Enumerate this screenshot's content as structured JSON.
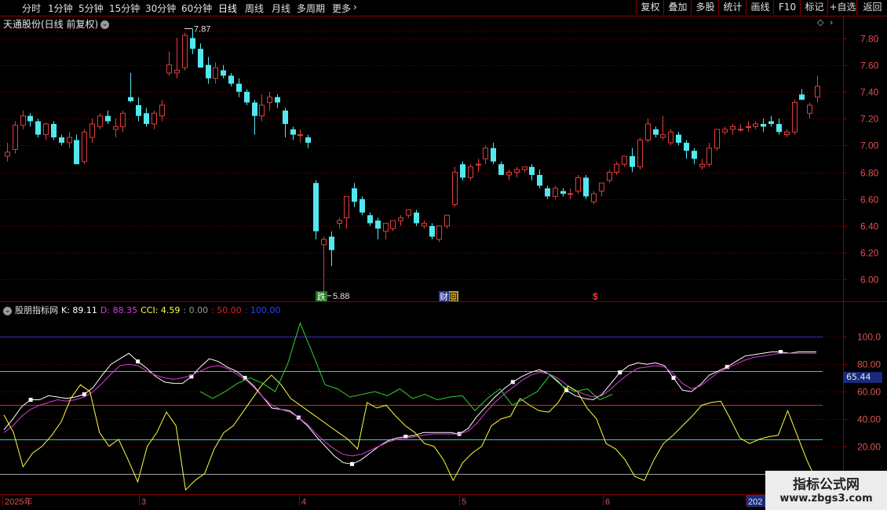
{
  "toolbar": {
    "left_items": [
      "分时",
      "1分钟",
      "5分钟",
      "15分钟",
      "30分钟",
      "60分钟",
      "日线",
      "周线",
      "月线",
      "多周期",
      "更多"
    ],
    "active": "日线",
    "right_items": [
      "复权",
      "叠加",
      "多股",
      "统计",
      "画线",
      "F10",
      "+自选",
      "返回",
      "标记"
    ]
  },
  "stock_title": "天通股份(日线 前复权)",
  "price_axis": [
    "7.80",
    "7.60",
    "7.40",
    "7.20",
    "7.00",
    "6.80",
    "6.60",
    "6.40",
    "6.20",
    "6.00"
  ],
  "indicator_axis": [
    "100.0",
    "80.00",
    "60.00",
    "40.00",
    "20.00"
  ],
  "current_value_label": "65.44",
  "high_label": "7.87",
  "low_label": "5.88",
  "event_markers": {
    "down": "跌",
    "finance": "财",
    "back": "回",
    "dollar": "$"
  },
  "indicator_legend": {
    "name": "股朋指标网",
    "k": "K: 89.11",
    "d": "D: 88.35",
    "cci": "CCI: 4.59",
    "l0": ": 0.00",
    "l50": ": 50.00",
    "l100": ": 100.00"
  },
  "date_labels": [
    "2025年",
    "3",
    "4",
    "5",
    "6",
    "202"
  ],
  "watermark": {
    "title": "指标公式网",
    "url": "www.zbgs3.com"
  },
  "colors": {
    "up": "#e03c3c",
    "down": "#52e8ee",
    "k": "#ffffff",
    "d": "#d040d0",
    "cci": "#ffff40",
    "rsi_green": "#30d030",
    "grid": "#8b0000"
  },
  "chart_data": [
    {
      "type": "candlestick",
      "title": "天通股份(日线 前复权)",
      "ylim": [
        5.85,
        7.92
      ],
      "candles_ohlc": [
        [
          6.92,
          7.02,
          6.88,
          6.95
        ],
        [
          6.97,
          7.18,
          6.94,
          7.15
        ],
        [
          7.15,
          7.26,
          7.12,
          7.22
        ],
        [
          7.22,
          7.24,
          7.14,
          7.18
        ],
        [
          7.18,
          7.2,
          7.06,
          7.08
        ],
        [
          7.08,
          7.17,
          7.04,
          7.16
        ],
        [
          7.16,
          7.18,
          7.04,
          7.06
        ],
        [
          7.06,
          7.08,
          7.0,
          7.02
        ],
        [
          7.02,
          7.1,
          6.98,
          7.06
        ],
        [
          7.04,
          7.08,
          6.88,
          6.86
        ],
        [
          6.88,
          7.12,
          6.86,
          7.1
        ],
        [
          7.06,
          7.2,
          7.02,
          7.16
        ],
        [
          7.14,
          7.24,
          7.12,
          7.22
        ],
        [
          7.22,
          7.26,
          7.16,
          7.18
        ],
        [
          7.12,
          7.2,
          7.06,
          7.14
        ],
        [
          7.14,
          7.26,
          7.1,
          7.24
        ],
        [
          7.36,
          7.54,
          7.32,
          7.33
        ],
        [
          7.3,
          7.36,
          7.18,
          7.22
        ],
        [
          7.24,
          7.28,
          7.14,
          7.16
        ],
        [
          7.16,
          7.26,
          7.12,
          7.24
        ],
        [
          7.22,
          7.34,
          7.18,
          7.3
        ],
        [
          7.54,
          7.7,
          7.52,
          7.6
        ],
        [
          7.54,
          7.8,
          7.5,
          7.56
        ],
        [
          7.58,
          7.84,
          7.56,
          7.82
        ],
        [
          7.8,
          7.87,
          7.68,
          7.72
        ],
        [
          7.72,
          7.76,
          7.58,
          7.58
        ],
        [
          7.6,
          7.66,
          7.46,
          7.5
        ],
        [
          7.5,
          7.62,
          7.46,
          7.58
        ],
        [
          7.56,
          7.6,
          7.5,
          7.52
        ],
        [
          7.52,
          7.54,
          7.44,
          7.46
        ],
        [
          7.46,
          7.5,
          7.36,
          7.4
        ],
        [
          7.4,
          7.42,
          7.3,
          7.32
        ],
        [
          7.32,
          7.34,
          7.08,
          7.22
        ],
        [
          7.22,
          7.38,
          7.18,
          7.3
        ],
        [
          7.32,
          7.4,
          7.26,
          7.36
        ],
        [
          7.36,
          7.38,
          7.28,
          7.32
        ],
        [
          7.26,
          7.28,
          7.06,
          7.16
        ],
        [
          7.12,
          7.14,
          7.04,
          7.08
        ],
        [
          7.08,
          7.12,
          7.02,
          7.08
        ],
        [
          7.06,
          7.08,
          6.98,
          7.02
        ],
        [
          6.72,
          6.74,
          6.3,
          6.36
        ],
        [
          6.26,
          6.32,
          5.88,
          6.3
        ],
        [
          6.32,
          6.36,
          6.1,
          6.22
        ],
        [
          6.42,
          6.46,
          6.38,
          6.44
        ],
        [
          6.46,
          6.62,
          6.38,
          6.62
        ],
        [
          6.68,
          6.72,
          6.54,
          6.58
        ],
        [
          6.6,
          6.62,
          6.48,
          6.5
        ],
        [
          6.48,
          6.5,
          6.4,
          6.42
        ],
        [
          6.44,
          6.46,
          6.3,
          6.38
        ],
        [
          6.36,
          6.42,
          6.3,
          6.42
        ],
        [
          6.38,
          6.44,
          6.36,
          6.44
        ],
        [
          6.44,
          6.48,
          6.4,
          6.46
        ],
        [
          6.48,
          6.52,
          6.46,
          6.52
        ],
        [
          6.5,
          6.52,
          6.4,
          6.42
        ],
        [
          6.4,
          6.44,
          6.38,
          6.42
        ],
        [
          6.4,
          6.42,
          6.3,
          6.32
        ],
        [
          6.3,
          6.4,
          6.28,
          6.4
        ],
        [
          6.4,
          6.48,
          6.38,
          6.48
        ],
        [
          6.56,
          6.84,
          6.54,
          6.8
        ],
        [
          6.86,
          6.88,
          6.74,
          6.76
        ],
        [
          6.76,
          6.86,
          6.74,
          6.84
        ],
        [
          6.86,
          6.9,
          6.8,
          6.86
        ],
        [
          6.9,
          7.0,
          6.86,
          6.98
        ],
        [
          6.98,
          7.02,
          6.86,
          6.88
        ],
        [
          6.86,
          6.88,
          6.78,
          6.78
        ],
        [
          6.78,
          6.82,
          6.74,
          6.8
        ],
        [
          6.8,
          6.84,
          6.76,
          6.82
        ],
        [
          6.82,
          6.84,
          6.8,
          6.84
        ],
        [
          6.84,
          6.86,
          6.74,
          6.78
        ],
        [
          6.78,
          6.82,
          6.68,
          6.7
        ],
        [
          6.68,
          6.7,
          6.6,
          6.62
        ],
        [
          6.62,
          6.7,
          6.6,
          6.68
        ],
        [
          6.66,
          6.68,
          6.62,
          6.64
        ],
        [
          6.64,
          6.68,
          6.6,
          6.64
        ],
        [
          6.66,
          6.78,
          6.64,
          6.76
        ],
        [
          6.76,
          6.78,
          6.6,
          6.62
        ],
        [
          6.58,
          6.66,
          6.56,
          6.64
        ],
        [
          6.66,
          6.72,
          6.62,
          6.72
        ],
        [
          6.74,
          6.82,
          6.72,
          6.8
        ],
        [
          6.8,
          6.88,
          6.78,
          6.86
        ],
        [
          6.86,
          6.92,
          6.84,
          6.92
        ],
        [
          6.92,
          6.98,
          6.8,
          6.84
        ],
        [
          6.84,
          7.06,
          6.82,
          7.04
        ],
        [
          7.04,
          7.2,
          7.02,
          7.16
        ],
        [
          7.12,
          7.14,
          7.06,
          7.08
        ],
        [
          7.06,
          7.22,
          7.04,
          7.08
        ],
        [
          7.02,
          7.12,
          7.0,
          7.1
        ],
        [
          7.08,
          7.1,
          7.0,
          7.02
        ],
        [
          7.02,
          7.04,
          6.9,
          6.96
        ],
        [
          6.96,
          6.98,
          6.86,
          6.9
        ],
        [
          6.84,
          6.9,
          6.82,
          6.86
        ],
        [
          6.86,
          7.02,
          6.84,
          6.98
        ],
        [
          6.98,
          7.12,
          6.96,
          7.12
        ],
        [
          7.1,
          7.14,
          7.08,
          7.12
        ],
        [
          7.12,
          7.16,
          7.08,
          7.14
        ],
        [
          7.12,
          7.16,
          7.1,
          7.12
        ],
        [
          7.14,
          7.18,
          7.1,
          7.14
        ],
        [
          7.14,
          7.18,
          7.12,
          7.16
        ],
        [
          7.16,
          7.2,
          7.1,
          7.14
        ],
        [
          7.18,
          7.22,
          7.14,
          7.16
        ],
        [
          7.16,
          7.2,
          7.08,
          7.1
        ],
        [
          7.08,
          7.12,
          7.06,
          7.1
        ],
        [
          7.1,
          7.34,
          7.08,
          7.32
        ],
        [
          7.38,
          7.42,
          7.34,
          7.34
        ],
        [
          7.24,
          7.32,
          7.2,
          7.3
        ],
        [
          7.36,
          7.52,
          7.32,
          7.44
        ]
      ]
    },
    {
      "type": "line",
      "title": "股朋指标网",
      "ylim": [
        -14,
        118
      ],
      "reference_lines": [
        {
          "value": 100,
          "color": "#2040ff"
        },
        {
          "value": 75,
          "color": "#40c8c8"
        },
        {
          "value": 50,
          "color": "#e02020"
        },
        {
          "value": 25,
          "color": "#40c8c8"
        },
        {
          "value": 0,
          "color": "#a0a0a0"
        }
      ],
      "series": [
        {
          "name": "K",
          "color": "#ffffff",
          "values": [
            32,
            40,
            49,
            54,
            54,
            57,
            56,
            55,
            56,
            58,
            63,
            72,
            80,
            84,
            88,
            82,
            77,
            71,
            67,
            66,
            66,
            71,
            78,
            84,
            82,
            78,
            75,
            70,
            64,
            56,
            48,
            47,
            46,
            41,
            35,
            27,
            20,
            13,
            8,
            7,
            10,
            15,
            20,
            24,
            26,
            27,
            28,
            30,
            30,
            30,
            30,
            29,
            33,
            42,
            49,
            56,
            62,
            67,
            71,
            74,
            76,
            73,
            68,
            61,
            57,
            55,
            54,
            58,
            66,
            74,
            79,
            81,
            80,
            81,
            79,
            70,
            61,
            60,
            65,
            72,
            75,
            78,
            82,
            86,
            87,
            88,
            89,
            89,
            88,
            89,
            89,
            89
          ]
        },
        {
          "name": "D",
          "color": "#d040d0",
          "values": [
            30,
            35,
            42,
            47,
            50,
            52,
            54,
            53,
            54,
            56,
            60,
            66,
            73,
            79,
            80,
            79,
            75,
            72,
            70,
            69,
            70,
            72,
            75,
            78,
            79,
            77,
            73,
            69,
            63,
            56,
            50,
            47,
            45,
            41,
            36,
            29,
            23,
            18,
            14,
            13,
            14,
            17,
            20,
            23,
            25,
            26,
            27,
            28,
            29,
            29,
            29,
            29,
            31,
            37,
            45,
            52,
            58,
            63,
            68,
            72,
            74,
            73,
            70,
            65,
            61,
            58,
            56,
            57,
            62,
            68,
            73,
            77,
            78,
            79,
            78,
            73,
            66,
            62,
            64,
            69,
            74,
            77,
            80,
            83,
            85,
            86,
            87,
            88,
            88,
            88,
            88,
            88
          ]
        },
        {
          "name": "CCI",
          "color": "#ffff40",
          "values": [
            43,
            30,
            5,
            15,
            20,
            28,
            38,
            55,
            65,
            60,
            30,
            20,
            25,
            10,
            -6,
            20,
            30,
            45,
            35,
            -12,
            -5,
            0,
            18,
            30,
            35,
            45,
            55,
            65,
            72,
            65,
            55,
            50,
            45,
            40,
            35,
            30,
            25,
            18,
            52,
            48,
            50,
            42,
            35,
            30,
            22,
            20,
            10,
            -5,
            8,
            15,
            20,
            35,
            40,
            42,
            55,
            50,
            46,
            45,
            52,
            64,
            60,
            48,
            40,
            22,
            18,
            10,
            -2,
            -5,
            10,
            22,
            28,
            35,
            42,
            50,
            52,
            53,
            40,
            26,
            22,
            25,
            27,
            28,
            46,
            28,
            10,
            -5
          ]
        },
        {
          "name": "RSI",
          "color": "#30d030",
          "values": [
            60,
            55,
            60,
            66,
            70,
            66,
            60,
            80,
            110,
            88,
            65,
            62,
            56,
            58,
            60,
            57,
            62,
            55,
            58,
            54,
            56,
            57,
            46,
            55,
            62,
            50,
            55,
            60,
            72,
            64,
            60,
            62,
            54,
            58
          ]
        }
      ]
    }
  ]
}
